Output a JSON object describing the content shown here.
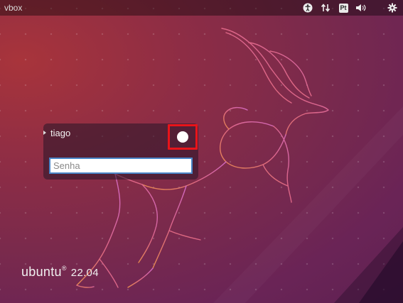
{
  "topbar": {
    "hostname": "vbox",
    "indicators": [
      {
        "name": "accessibility-icon"
      },
      {
        "name": "network-arrows-icon"
      },
      {
        "name": "keyboard-layout-indicator",
        "label": "Pt"
      },
      {
        "name": "volume-icon"
      },
      {
        "name": "gear-icon"
      }
    ],
    "keyboard_label": "Pt"
  },
  "login": {
    "username": "tiago",
    "password_placeholder": "Senha",
    "password_value": ""
  },
  "branding": {
    "name": "ubuntu",
    "registered": "®",
    "version": "22.04"
  },
  "colors": {
    "background_start": "#a8343b",
    "background_end": "#5e2152",
    "highlight_border": "#e8141a",
    "input_focus_border": "#4a86c8"
  }
}
